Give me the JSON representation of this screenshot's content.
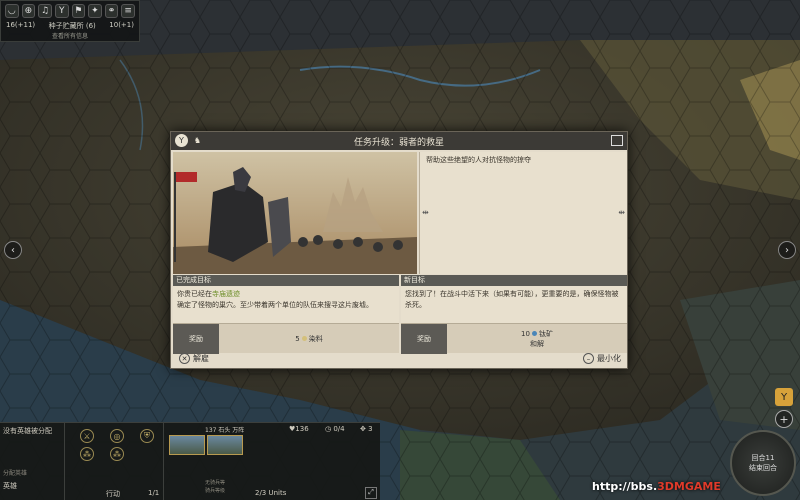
{
  "top_bar": {
    "stats": [
      "16(+11)",
      "种子贮藏所",
      "(6)",
      "10(+1)"
    ],
    "sub": "查看所有信息"
  },
  "dialog": {
    "title": "任务升级：弱者的救星",
    "description": "帮助这些绝望的人对抗怪物的掠夺",
    "completed": {
      "header": "已完成目标",
      "text_prefix": "你贵已经在",
      "text_highlight": "寺庙遗迹",
      "text_rest": "确定了怪物的巢穴。至少带着两个单位的队伍来搜寻这片废墟。",
      "reward_label": "奖励",
      "reward_value": "5",
      "reward_name": "染料"
    },
    "new_goal": {
      "header": "新目标",
      "text": "您找到了！在战斗中活下来（如果有可能），更重要的是，确保怪物被杀死。",
      "reward_label": "奖励",
      "reward_value": "10",
      "reward_name": "钛矿",
      "reward_extra": "和解"
    },
    "dismiss_label": "解雇",
    "minimize_label": "最小化"
  },
  "bottom_bar": {
    "hero_text": "没有英雄被分配",
    "assign_label": "分配英雄",
    "hero_label": "英雄",
    "action_label": "行动",
    "action_count": "1/1",
    "army_title": "137 石头 万阵",
    "hp": "136",
    "moves": "0/4",
    "power": "3",
    "units_label": "2/3 Units",
    "unit_names": [
      "无骑兵等",
      "骑兵等级"
    ]
  },
  "end_turn": {
    "turn_text": "回合11",
    "end_label": "结束回合"
  },
  "watermark": {
    "url": "http://bbs.",
    "brand": "3DMGAME"
  },
  "colors": {
    "dialog_bg": "#e4dccb",
    "header_dark": "#3c3a36",
    "highlight_green": "#6d8e28",
    "gold": "#d7a23a"
  }
}
